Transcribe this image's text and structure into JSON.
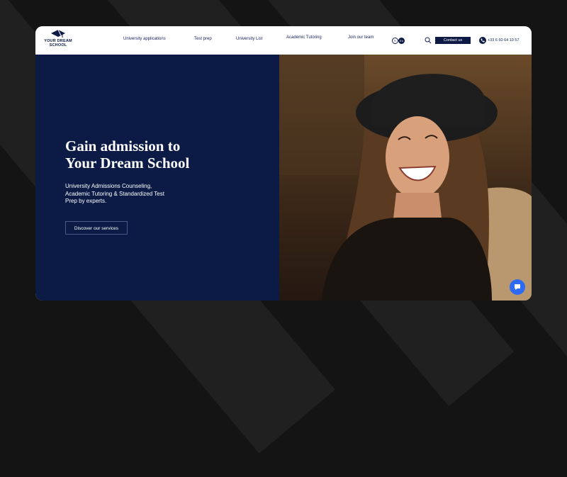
{
  "brand": {
    "logo_line1": "YOUR DREAM",
    "logo_line2": "SCHOOL"
  },
  "nav": {
    "items": [
      "University applications",
      "Test prep",
      "University List",
      "Academic Tutoring",
      "Join our team"
    ],
    "lang_fr": "Fr",
    "lang_en": "En",
    "contact_label": "Contact us",
    "phone": "+33 6 60 64 19 57"
  },
  "hero": {
    "title_line1": "Gain admission to",
    "title_line2": "Your Dream School",
    "subtitle": "University Admissions Counseling, Academic Tutoring & Standardized Test Prep by experts.",
    "cta_label": "Discover our services"
  },
  "colors": {
    "navy": "#0b1b45",
    "chat": "#2d6cf2"
  },
  "icons": [
    "search-icon",
    "phone-icon",
    "chat-icon",
    "graduation-cap-icon"
  ]
}
